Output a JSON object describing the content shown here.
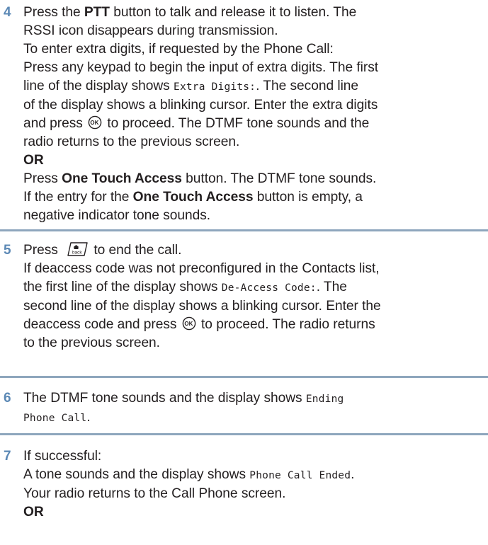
{
  "step4": {
    "num": "4",
    "l1_a": "Press the ",
    "l1_b": "PTT",
    "l1_c": " button to talk and release it to listen. The",
    "l2": "RSSI icon disappears during transmission.",
    "l3": "To enter extra digits, if requested by the Phone Call:",
    "l4": "Press any keypad to begin the input of extra digits. The first",
    "l5_a": "line of the display shows ",
    "l5_mono": "Extra Digits:",
    "l5_c": ". The second line",
    "l6": "of the display shows a blinking cursor. Enter the extra digits",
    "l7_a": "and press ",
    "l7_icon": "ok-button-icon",
    "l7_c": " to proceed. The DTMF tone sounds and the",
    "l8": "radio returns to the previous screen.",
    "l9": "OR",
    "l10_a": "Press ",
    "l10_b": "One Touch Access",
    "l10_c": " button. The DTMF tone sounds.",
    "l11_a": "If the entry for the ",
    "l11_b": "One Touch Access",
    "l11_c": " button is empty, a",
    "l12": "negative indicator tone sounds."
  },
  "step5": {
    "num": "5",
    "l1_a": "Press ",
    "l1_icon": "back-home-button-icon",
    "l1_c": " to end the call.",
    "l2": "If deaccess code was not preconfigured in the Contacts list,",
    "l3_a": "the first line of the display shows ",
    "l3_mono": "De-Access Code:",
    "l3_c": ". The",
    "l4": "second line of the display shows a blinking cursor. Enter the",
    "l5_a": "deaccess code and press ",
    "l5_icon": "ok-button-icon",
    "l5_c": " to proceed. The radio returns",
    "l6": "to the previous screen."
  },
  "step6": {
    "num": "6",
    "l1_a": "The DTMF tone sounds and the display shows ",
    "l1_mono": "Ending",
    "l2_mono": "Phone Call",
    "l2_c": "."
  },
  "step7": {
    "num": "7",
    "l1": "If successful:",
    "l2_a": "A tone sounds and the display shows ",
    "l2_mono": "Phone Call Ended",
    "l2_c": ".",
    "l3": "Your radio returns to the Call Phone screen.",
    "l4": "OR"
  },
  "colors": {
    "step_number": "#5b88b5",
    "divider": "#8ea6bd",
    "text": "#231f20"
  }
}
